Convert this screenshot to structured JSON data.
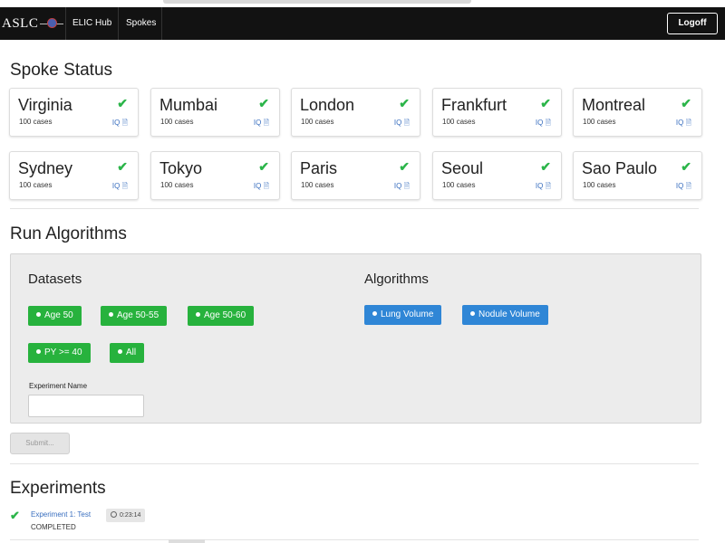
{
  "navbar": {
    "brand": "ASLC",
    "items": [
      "ELIC Hub",
      "Spokes"
    ],
    "logoff_label": "Logoff"
  },
  "spoke_status": {
    "title": "Spoke Status",
    "spokes": [
      {
        "name": "Virginia",
        "cases": "100 cases",
        "iq": "IQ"
      },
      {
        "name": "Mumbai",
        "cases": "100 cases",
        "iq": "IQ"
      },
      {
        "name": "London",
        "cases": "100 cases",
        "iq": "IQ"
      },
      {
        "name": "Frankfurt",
        "cases": "100 cases",
        "iq": "IQ"
      },
      {
        "name": "Montreal",
        "cases": "100 cases",
        "iq": "IQ"
      },
      {
        "name": "Sydney",
        "cases": "100 cases",
        "iq": "IQ"
      },
      {
        "name": "Tokyo",
        "cases": "100 cases",
        "iq": "IQ"
      },
      {
        "name": "Paris",
        "cases": "100 cases",
        "iq": "IQ"
      },
      {
        "name": "Seoul",
        "cases": "100 cases",
        "iq": "IQ"
      },
      {
        "name": "Sao Paulo",
        "cases": "100 cases",
        "iq": "IQ"
      }
    ]
  },
  "run_algorithms": {
    "title": "Run Algorithms",
    "datasets_label": "Datasets",
    "datasets": [
      "Age 50",
      "Age 50-55",
      "Age 50-60",
      "PY >= 40",
      "All"
    ],
    "algorithms_label": "Algorithms",
    "algorithms": [
      "Lung Volume",
      "Nodule Volume"
    ],
    "experiment_name_label": "Experiment Name",
    "experiment_name_value": "",
    "submit_label": "Submit..."
  },
  "experiments": {
    "title": "Experiments",
    "items": [
      {
        "name": "Experiment 1: Test",
        "time": "0:23:14",
        "status": "COMPLETED"
      }
    ]
  },
  "colors": {
    "navbar": "#121212",
    "success": "#2cb54a",
    "dataset_tag": "#27b23d",
    "algorithm_tag": "#2f86d6",
    "link": "#3a6fbf"
  }
}
